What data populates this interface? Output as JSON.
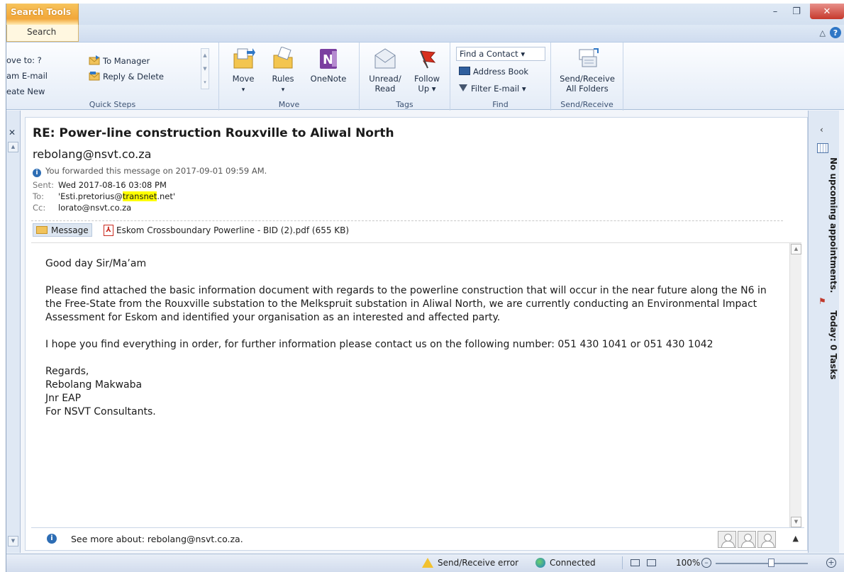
{
  "titlebar": {
    "context_tab": "Search Tools",
    "active_tab": "Search",
    "minimize": "–",
    "restore": "❐",
    "close": "✕",
    "help": "?",
    "collapse": "△"
  },
  "ribbon": {
    "quick_steps": {
      "label": "Quick Steps",
      "items": [
        "ove to: ?",
        "am E-mail",
        "eate New"
      ],
      "to_manager": "To Manager",
      "reply_delete": "Reply & Delete"
    },
    "move": {
      "label": "Move",
      "move_btn": "Move",
      "rules_btn": "Rules",
      "onenote_btn": "OneNote"
    },
    "tags": {
      "label": "Tags",
      "unread_read_1": "Unread/",
      "unread_read_2": "Read",
      "follow_up_1": "Follow",
      "follow_up_2": "Up ▾"
    },
    "find": {
      "label": "Find",
      "find_contact": "Find a Contact ▾",
      "address_book": "Address Book",
      "filter_email": "Filter E-mail ▾"
    },
    "send_receive": {
      "label": "Send/Receive",
      "btn_1": "Send/Receive",
      "btn_2": "All Folders"
    }
  },
  "message": {
    "subject": "RE: Power-line construction Rouxville to Aliwal North",
    "sender": "rebolang@nsvt.co.za",
    "forward_note": "You forwarded this message on 2017-09-01 09:59 AM.",
    "sent_label": "Sent:",
    "sent_value": "Wed 2017-08-16 03:08 PM",
    "to_label": "To:",
    "to_prefix": "'Esti.pretorius@",
    "to_highlight": "transnet",
    "to_suffix": ".net'",
    "cc_label": "Cc:",
    "cc_value": "lorato@nsvt.co.za",
    "attach_message": "Message",
    "attach_file": "Eskom Crossboundary Powerline - BID (2).pdf (655 KB)",
    "body": {
      "greeting": "Good day Sir/Ma’am",
      "p1": "Please find attached the basic information document with regards to the powerline construction that will occur in the near future along the N6 in the Free-State from the Rouxville substation to the Melkspruit substation in Aliwal North, we are currently conducting an Environmental Impact Assessment for Eskom and identified your organisation as an interested and affected party.",
      "p2": "I hope you find everything in order, for further information please contact us on the following number: 051 430 1041 or 051 430 1042",
      "sig_1": "Regards,",
      "sig_2": "Rebolang Makwaba",
      "sig_3": "Jnr EAP",
      "sig_4": "For NSVT Consultants."
    }
  },
  "people_pane": {
    "text": "See more about: rebolang@nsvt.co.za."
  },
  "todo_bar": {
    "appointments": "No upcoming appointments.",
    "tasks": "Today: 0 Tasks"
  },
  "statusbar": {
    "error": "Send/Receive error",
    "connected": "Connected",
    "zoom": "100%"
  }
}
